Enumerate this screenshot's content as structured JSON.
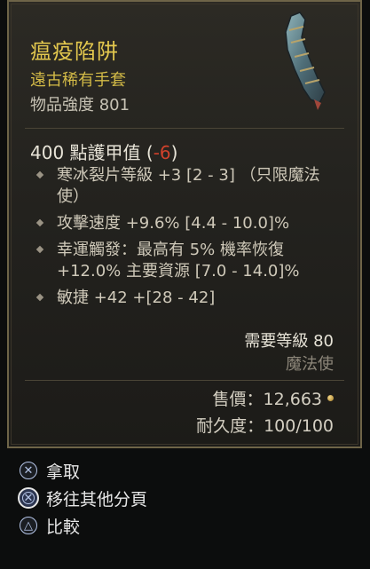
{
  "item": {
    "name": "瘟疫陷阱",
    "rarity_type": "遠古稀有手套",
    "item_power": "物品強度 801",
    "armor_prefix": "400 點護甲值 (",
    "armor_delta": "-6",
    "armor_suffix": ")",
    "affixes": [
      "寒冰裂片等級 +3 [2 - 3] （只限魔法使）",
      "攻擊速度 +9.6% [4.4 - 10.0]%",
      "幸運觸發：最高有 5% 機率恢復 +12.0% 主要資源 [7.0 - 14.0]%",
      "敏捷 +42 +[28 - 42]"
    ],
    "required_level": "需要等級 80",
    "required_class": "魔法使",
    "sell_price": "售價：12,663",
    "durability": "耐久度：100/100"
  },
  "colors": {
    "title": "#e3c84e",
    "negative": "#d0412b",
    "frame": "#6e6448"
  },
  "actions": [
    {
      "label": "拿取",
      "icon": "cross-button-icon"
    },
    {
      "label": "移往其他分頁",
      "icon": "cross-button-icon"
    },
    {
      "label": "比較",
      "icon": "triangle-button-icon"
    }
  ]
}
